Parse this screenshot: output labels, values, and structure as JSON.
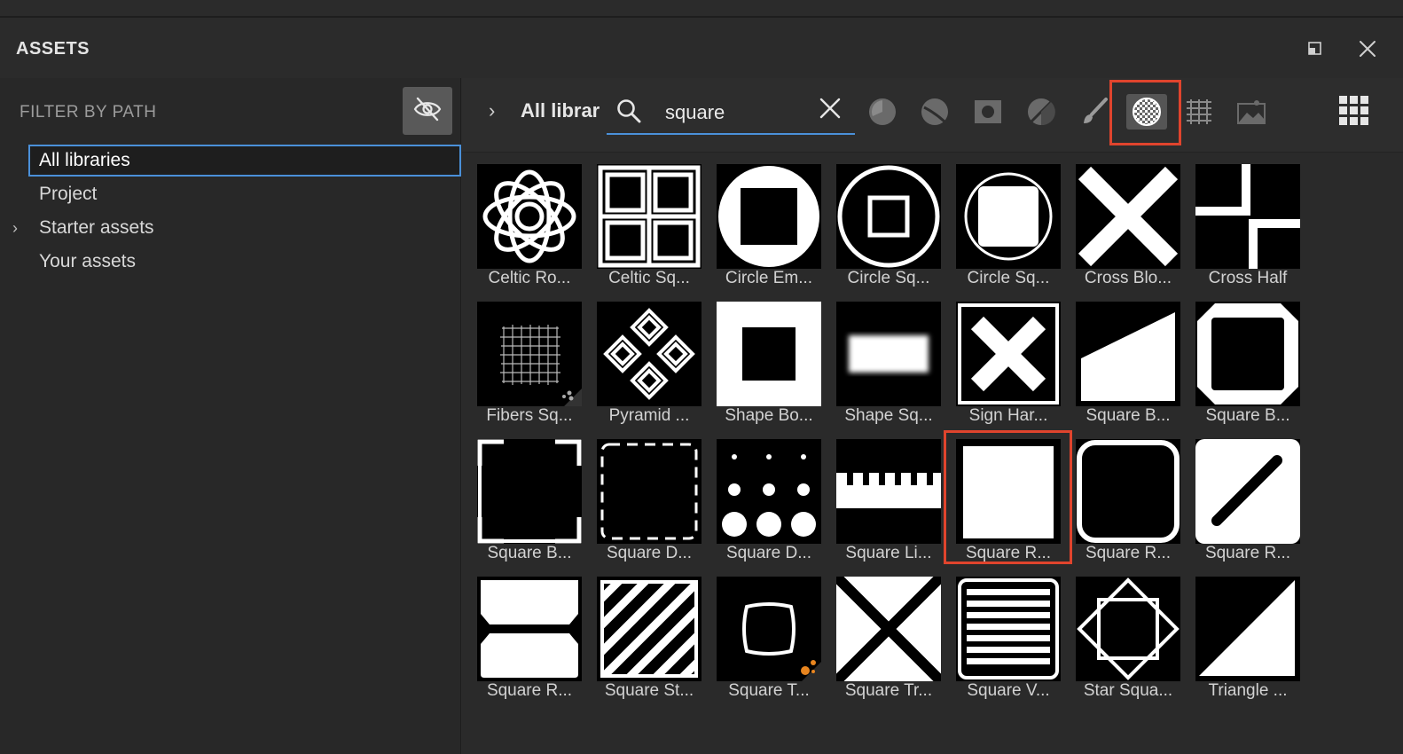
{
  "panel": {
    "title": "ASSETS"
  },
  "left": {
    "filter_label": "FILTER BY PATH",
    "tree": [
      {
        "label": "All libraries",
        "selected": true,
        "expandable": false
      },
      {
        "label": "Project",
        "selected": false,
        "expandable": false
      },
      {
        "label": "Starter assets",
        "selected": false,
        "expandable": true
      },
      {
        "label": "Your assets",
        "selected": false,
        "expandable": false
      }
    ]
  },
  "toolbar": {
    "breadcrumb": "All librar",
    "search_value": "square",
    "filters": [
      {
        "name": "material-filter",
        "active": false
      },
      {
        "name": "smart-material-filter",
        "active": false
      },
      {
        "name": "mask-filter",
        "active": false
      },
      {
        "name": "smart-mask-filter",
        "active": false
      },
      {
        "name": "brush-filter",
        "active": false
      },
      {
        "name": "texture-filter",
        "active": true
      },
      {
        "name": "procedural-filter",
        "active": false
      },
      {
        "name": "environment-filter",
        "active": false
      }
    ],
    "highlight_color": "#e0442d",
    "accent_color": "#4a90d9"
  },
  "assets": [
    {
      "label": "Celtic Ro...",
      "icon": "celtic-rosette"
    },
    {
      "label": "Celtic Sq...",
      "icon": "celtic-square"
    },
    {
      "label": "Circle Em...",
      "icon": "circle-embossed-square"
    },
    {
      "label": "Circle Sq...",
      "icon": "circle-square-outline"
    },
    {
      "label": "Circle Sq...",
      "icon": "circle-square-filled"
    },
    {
      "label": "Cross Blo...",
      "icon": "cross-block"
    },
    {
      "label": "Cross Half",
      "icon": "cross-half"
    },
    {
      "label": "Fibers Sq...",
      "icon": "fibers-square"
    },
    {
      "label": "Pyramid ...",
      "icon": "pyramid-diamonds"
    },
    {
      "label": "Shape Bo...",
      "icon": "shape-border"
    },
    {
      "label": "Shape Sq...",
      "icon": "shape-square-blurred"
    },
    {
      "label": "Sign Har...",
      "icon": "sign-hard-cross"
    },
    {
      "label": "Square B...",
      "icon": "square-bevel-ramp"
    },
    {
      "label": "Square B...",
      "icon": "square-bevel-octagon"
    },
    {
      "label": "Square B...",
      "icon": "square-brackets"
    },
    {
      "label": "Square D...",
      "icon": "square-dashed"
    },
    {
      "label": "Square D...",
      "icon": "square-dots"
    },
    {
      "label": "Square Li...",
      "icon": "square-lines"
    },
    {
      "label": "Square R...",
      "icon": "square-rounded-white",
      "highlighted": true
    },
    {
      "label": "Square R...",
      "icon": "square-rounded-outline"
    },
    {
      "label": "Square R...",
      "icon": "square-rounded-diagonal"
    },
    {
      "label": "Square R...",
      "icon": "square-rounded-split"
    },
    {
      "label": "Square St...",
      "icon": "square-stripes"
    },
    {
      "label": "Square T...",
      "icon": "square-tile-bulge"
    },
    {
      "label": "Square Tr...",
      "icon": "square-triangles-x"
    },
    {
      "label": "Square V...",
      "icon": "square-vertical-lines"
    },
    {
      "label": "Star Squa...",
      "icon": "star-square"
    },
    {
      "label": "Triangle ...",
      "icon": "triangle"
    }
  ]
}
